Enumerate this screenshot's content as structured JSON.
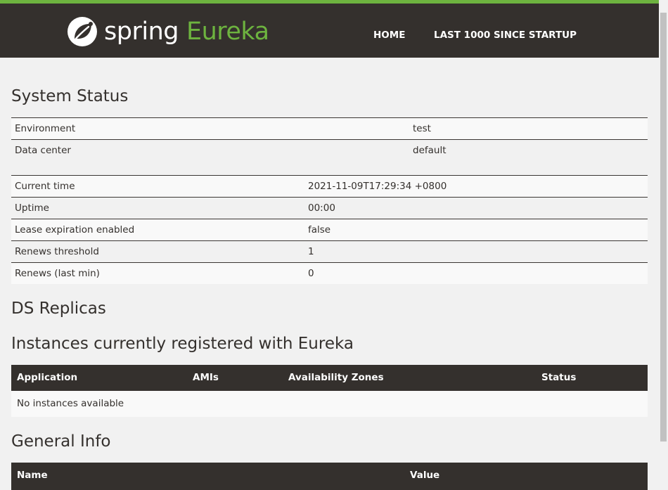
{
  "header": {
    "logo_spring": "spring",
    "logo_eureka": "Eureka",
    "nav": [
      "HOME",
      "LAST 1000 SINCE STARTUP"
    ],
    "colors": {
      "bar": "#34302d",
      "accent": "#6db33f"
    }
  },
  "system_status": {
    "title": "System Status",
    "env_rows": [
      {
        "label": "Environment",
        "value": "test"
      },
      {
        "label": "Data center",
        "value": "default"
      }
    ],
    "stat_rows": [
      {
        "label": "Current time",
        "value": "2021-11-09T17:29:34 +0800"
      },
      {
        "label": "Uptime",
        "value": "00:00"
      },
      {
        "label": "Lease expiration enabled",
        "value": "false"
      },
      {
        "label": "Renews threshold",
        "value": "1"
      },
      {
        "label": "Renews (last min)",
        "value": "0"
      }
    ]
  },
  "ds_replicas": {
    "title": "DS Replicas"
  },
  "instances": {
    "title": "Instances currently registered with Eureka",
    "columns": [
      "Application",
      "AMIs",
      "Availability Zones",
      "Status"
    ],
    "empty_message": "No instances available"
  },
  "general_info": {
    "title": "General Info",
    "columns": [
      "Name",
      "Value"
    ]
  }
}
